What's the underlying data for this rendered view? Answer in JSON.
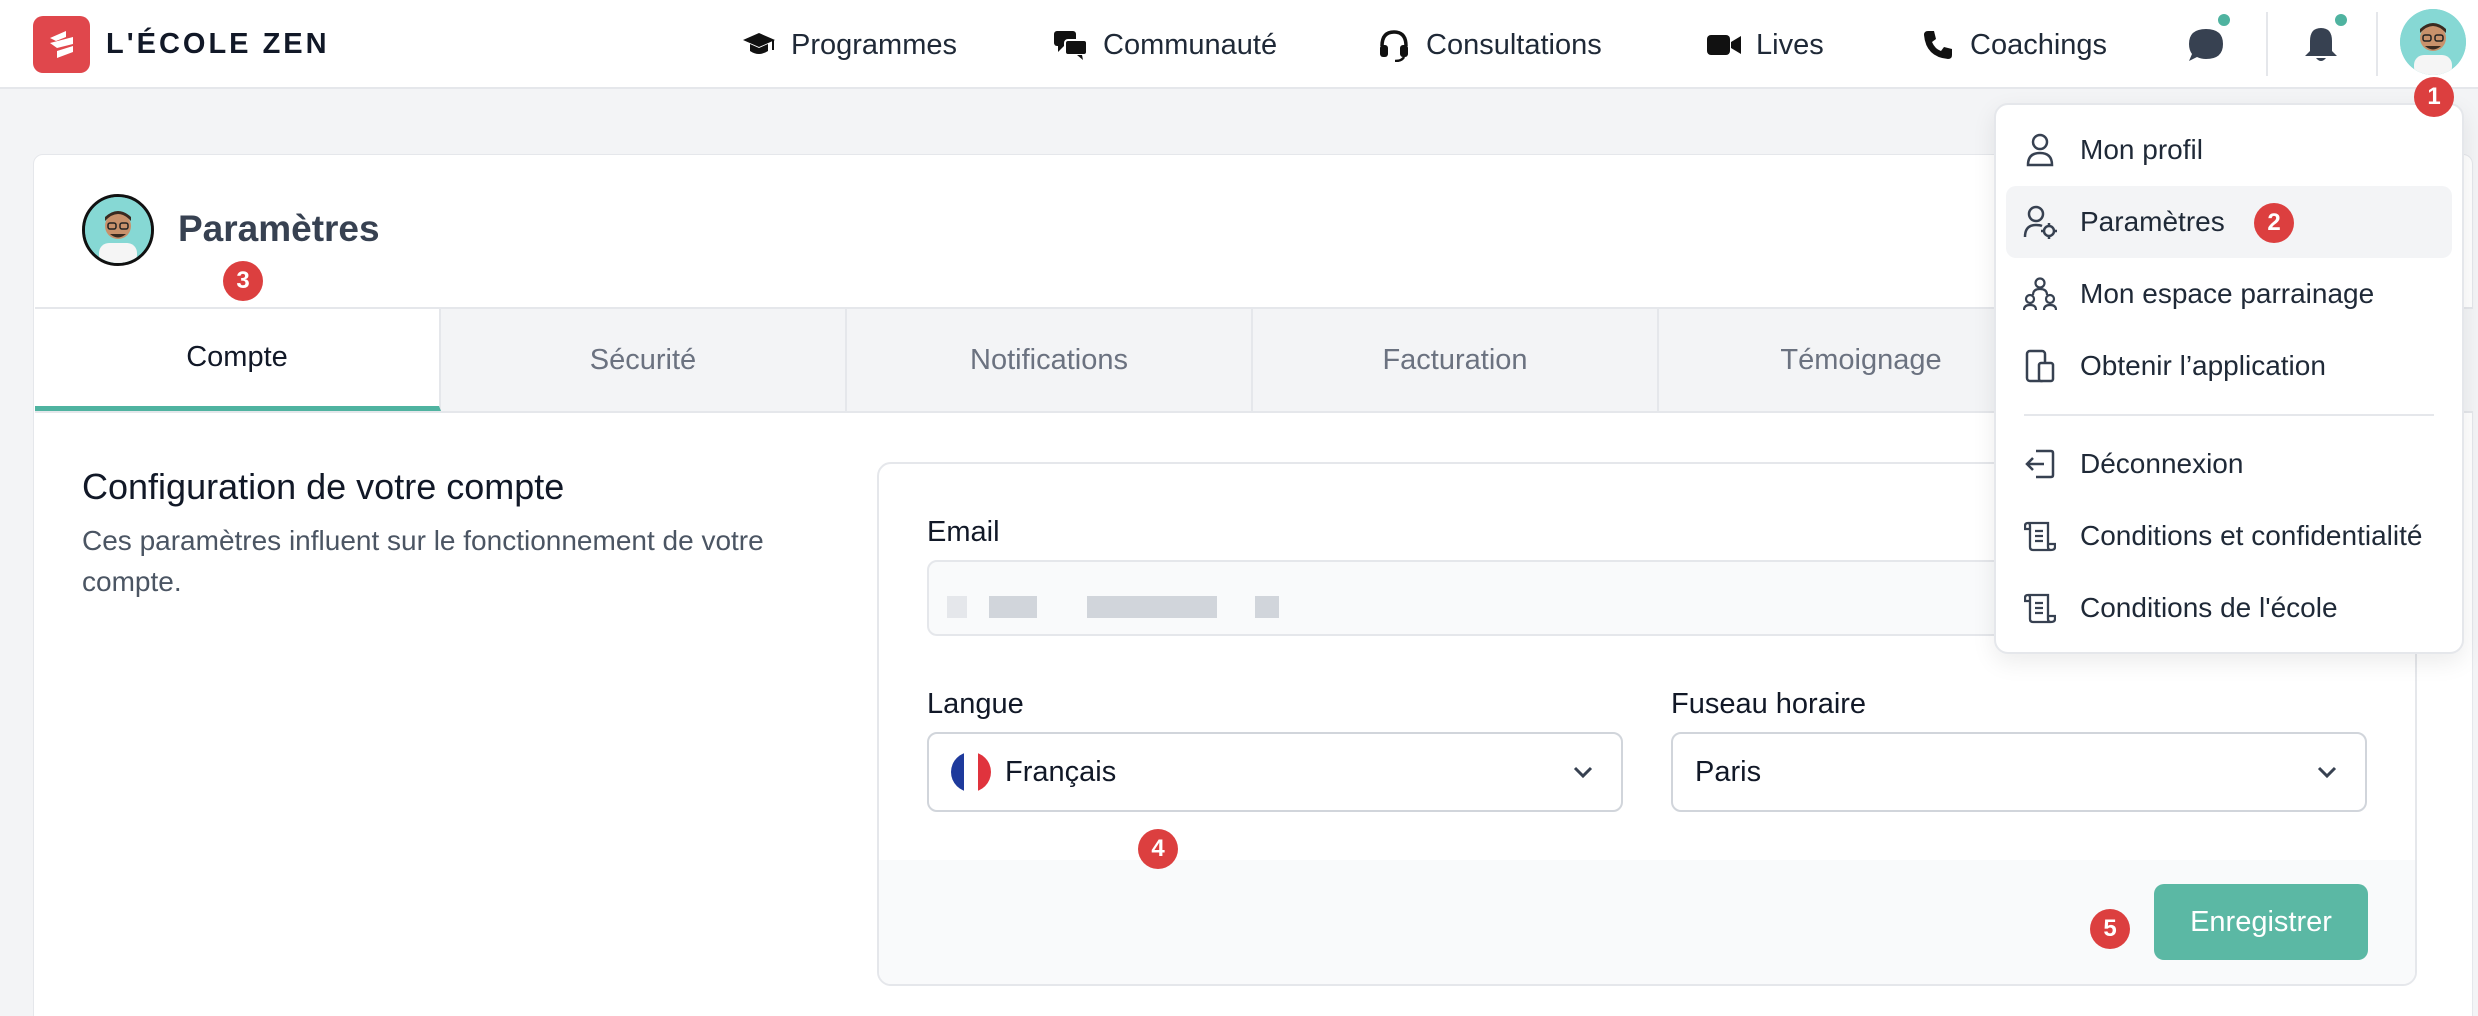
{
  "brand": {
    "name": "L'ÉCOLE ZEN"
  },
  "nav": [
    {
      "label": "Programmes",
      "icon": "graduation-cap-icon"
    },
    {
      "label": "Communauté",
      "icon": "chat-bubbles-icon"
    },
    {
      "label": "Consultations",
      "icon": "headset-icon"
    },
    {
      "label": "Lives",
      "icon": "video-camera-icon"
    },
    {
      "label": "Coachings",
      "icon": "phone-icon"
    }
  ],
  "header_icons": [
    "message-icon",
    "bell-icon",
    "user-avatar"
  ],
  "page": {
    "title": "Paramètres"
  },
  "tabs": [
    {
      "label": "Compte",
      "active": true
    },
    {
      "label": "Sécurité"
    },
    {
      "label": "Notifications"
    },
    {
      "label": "Facturation"
    },
    {
      "label": "Témoignage"
    }
  ],
  "section": {
    "title": "Configuration de votre compte",
    "description": "Ces paramètres influent sur le fonctionnement de votre compte."
  },
  "form": {
    "email_label": "Email",
    "language_label": "Langue",
    "language_value": "Français",
    "timezone_label": "Fuseau horaire",
    "timezone_value": "Paris",
    "save_label": "Enregistrer"
  },
  "dropdown": {
    "items": [
      {
        "label": "Mon profil",
        "icon": "user-icon"
      },
      {
        "label": "Paramètres",
        "icon": "user-cog-icon",
        "highlighted": true
      },
      {
        "label": "Mon espace parrainage",
        "icon": "users-icon"
      },
      {
        "label": "Obtenir l’application",
        "icon": "devices-icon"
      },
      {
        "label": "Déconnexion",
        "icon": "logout-icon"
      },
      {
        "label": "Conditions et confidentialité",
        "icon": "scroll-icon"
      },
      {
        "label": "Conditions de l'école",
        "icon": "scroll-icon"
      }
    ]
  },
  "badges": [
    "1",
    "2",
    "3",
    "4",
    "5"
  ],
  "colors": {
    "accent": "#4fb3a0",
    "brand": "#e0474c",
    "badge": "#dc3f3f",
    "button": "#5bb8a4"
  }
}
